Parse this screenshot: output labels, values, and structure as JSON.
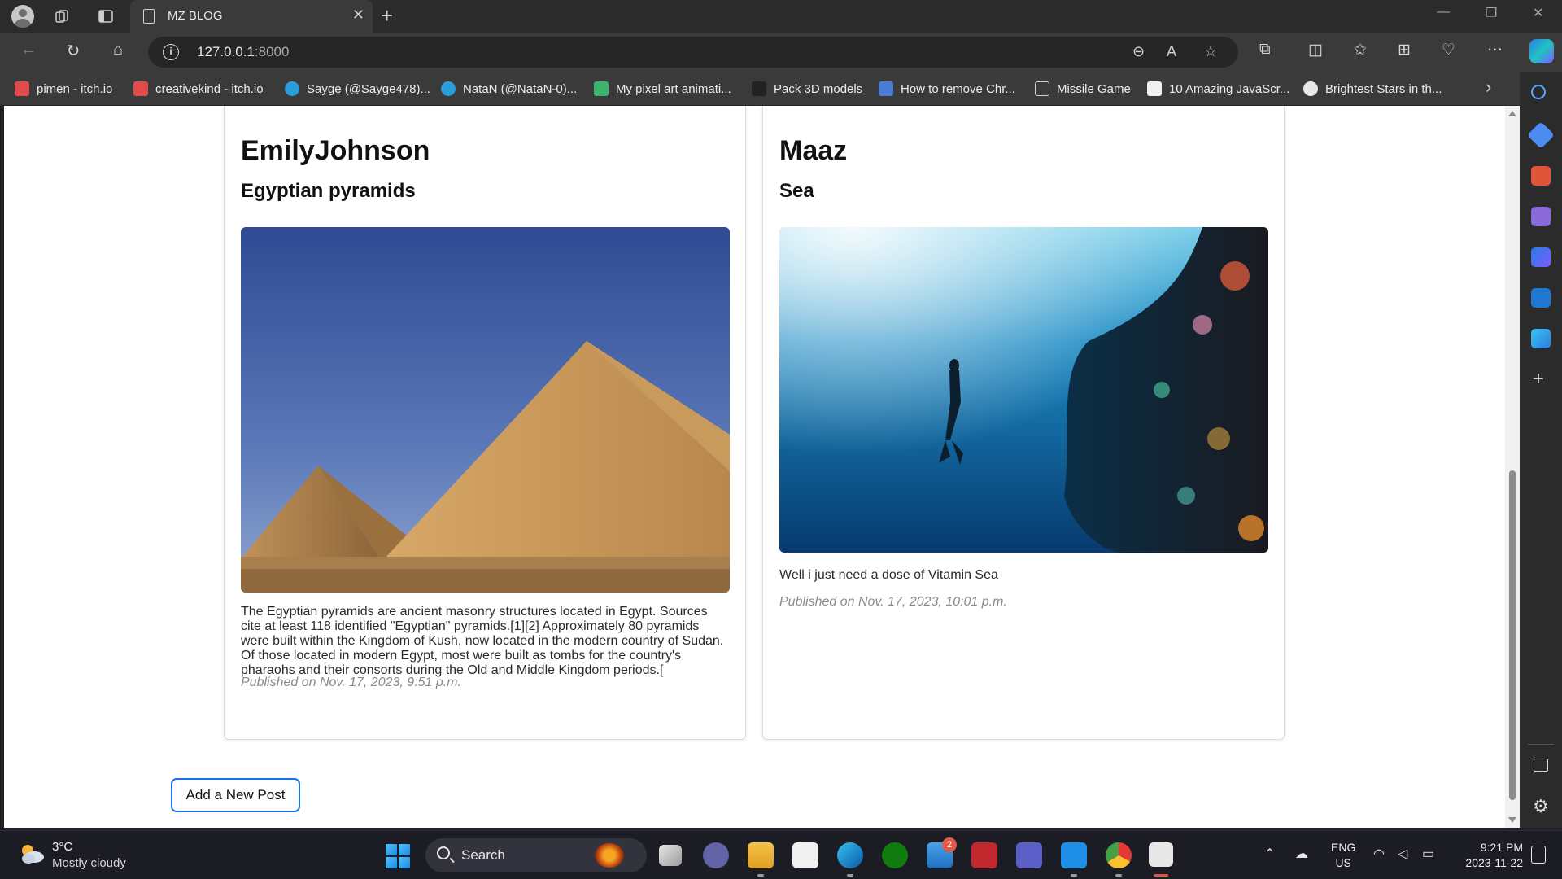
{
  "browser": {
    "tab_title": "MZ BLOG",
    "url_host": "127.0.0.1",
    "url_port": ":8000"
  },
  "bookmarks": [
    {
      "label": "pimen - itch.io",
      "color": "#e24b4b"
    },
    {
      "label": "creativekind - itch.io",
      "color": "#e24b4b"
    },
    {
      "label": "Sayge (@Sayge478)...",
      "color": "#2d9cdb"
    },
    {
      "label": "NataN (@NataN-0)...",
      "color": "#2d9cdb"
    },
    {
      "label": "My pixel art animati...",
      "color": "#3cb371"
    },
    {
      "label": "Pack 3D models",
      "color": "#333333"
    },
    {
      "label": "How to remove Chr...",
      "color": "#4a7bd0"
    },
    {
      "label": "Missile Game",
      "color": "#cfcfcf"
    },
    {
      "label": "10 Amazing JavaScr...",
      "color": "#f0f0f0"
    },
    {
      "label": "Brightest Stars in th...",
      "color": "#e8e8e8"
    }
  ],
  "posts": [
    {
      "author": "EmilyJohnson",
      "title": "Egyptian pyramids",
      "body": "The Egyptian pyramids are ancient masonry structures located in Egypt. Sources cite at least 118 identified \"Egyptian\" pyramids.[1][2] Approximately 80 pyramids were built within the Kingdom of Kush, now located in the modern country of Sudan. Of those located in modern Egypt, most were built as tombs for the country's pharaohs and their consorts during the Old and Middle Kingdom periods.[",
      "published": "Published on Nov. 17, 2023, 9:51 p.m."
    },
    {
      "author": "Maaz",
      "title": "Sea",
      "body": "Well i just need a dose of Vitamin Sea",
      "published": "Published on Nov. 17, 2023, 10:01 p.m."
    }
  ],
  "add_post_label": "Add a New Post",
  "taskbar": {
    "temperature": "3°C",
    "condition": "Mostly cloudy",
    "search_label": "Search",
    "mail_badge": "2",
    "lang_line1": "ENG",
    "lang_line2": "US",
    "time": "9:21 PM",
    "date": "2023-11-22"
  },
  "colors": {
    "accent": "#1a73e8",
    "page_bg": "#ffffff",
    "chrome_bg": "#3a3a3a"
  }
}
